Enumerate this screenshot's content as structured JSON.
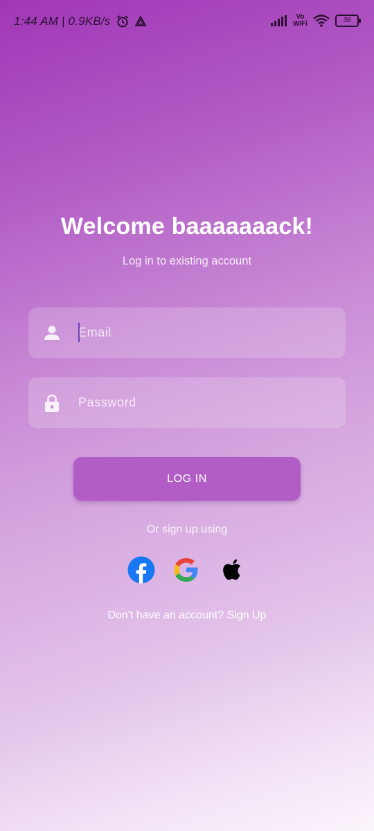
{
  "status_bar": {
    "time_speed": "1:44 AM | 0.9KB/s",
    "vowifi_top": "Vo",
    "vowifi_bottom": "WiFi",
    "battery": "38"
  },
  "login": {
    "title": "Welcome baaaaaaack!",
    "subtitle": "Log in to existing account",
    "email_placeholder": "Email",
    "email_value": "",
    "password_placeholder": "Password",
    "password_value": "",
    "login_button": "LOG IN",
    "or_text": "Or sign up using",
    "signup_text": "Don't have an account? Sign Up"
  },
  "social": [
    "facebook-icon",
    "google-icon",
    "apple-icon"
  ],
  "colors": {
    "gradient_top": "#a136b6",
    "gradient_bottom": "#fbf4fc",
    "button": "#b15dc5",
    "caret": "#6f3bb3"
  }
}
